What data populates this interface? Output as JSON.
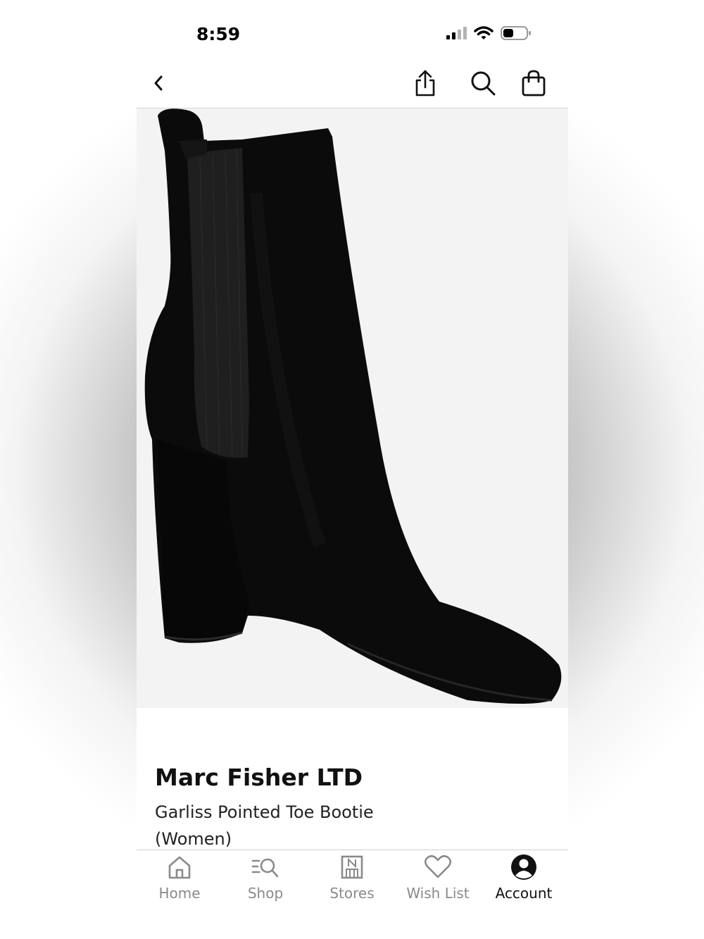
{
  "status_bar": {
    "time": "8:59"
  },
  "nav": {
    "back_icon": "chevron-left-icon",
    "actions": [
      "share-icon",
      "search-icon",
      "shopping-bag-icon"
    ]
  },
  "product": {
    "image_icon": "black-suede-bootie-photo",
    "brand": "Marc Fisher LTD",
    "name": "Garliss Pointed Toe Bootie (Women)"
  },
  "tabs": [
    {
      "label": "Home",
      "icon": "home-icon",
      "active": false
    },
    {
      "label": "Shop",
      "icon": "shop-search-icon",
      "active": false
    },
    {
      "label": "Stores",
      "icon": "store-icon",
      "active": false
    },
    {
      "label": "Wish List",
      "icon": "heart-icon",
      "active": false
    },
    {
      "label": "Account",
      "icon": "account-icon",
      "active": true
    }
  ],
  "colors": {
    "background": "#ffffff",
    "image_bg": "#f3f3f3",
    "inactive_tab": "#8a8a8a",
    "active_tab": "#111111"
  }
}
